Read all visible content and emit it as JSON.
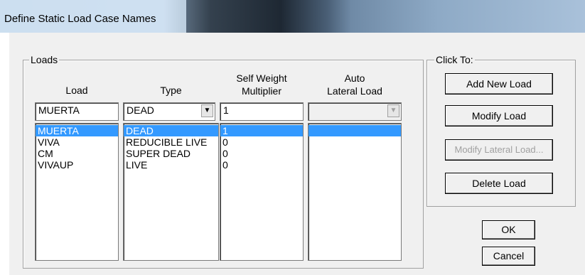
{
  "window": {
    "title": "Define Static Load Case Names"
  },
  "loads_group": {
    "legend": "Loads",
    "headers": {
      "load": "Load",
      "type": "Type",
      "self_weight": [
        "Self Weight",
        "Multiplier"
      ],
      "auto_lateral": [
        "Auto",
        "Lateral Load"
      ]
    },
    "inputs": {
      "load": "MUERTA",
      "type": "DEAD",
      "self_weight": "1",
      "auto_lateral": ""
    },
    "rows": [
      {
        "load": "MUERTA",
        "type": "DEAD",
        "multiplier": "1",
        "lateral": "",
        "selected": true
      },
      {
        "load": "VIVA",
        "type": "REDUCIBLE LIVE",
        "multiplier": "0",
        "lateral": "",
        "selected": false
      },
      {
        "load": "CM",
        "type": "SUPER DEAD",
        "multiplier": "0",
        "lateral": "",
        "selected": false
      },
      {
        "load": "VIVAUP",
        "type": "LIVE",
        "multiplier": "0",
        "lateral": "",
        "selected": false
      }
    ]
  },
  "click_group": {
    "legend": "Click To:",
    "add": "Add New Load",
    "modify": "Modify Load",
    "modify_lateral": "Modify Lateral Load...",
    "delete": "Delete Load"
  },
  "buttons": {
    "ok": "OK",
    "cancel": "Cancel"
  }
}
